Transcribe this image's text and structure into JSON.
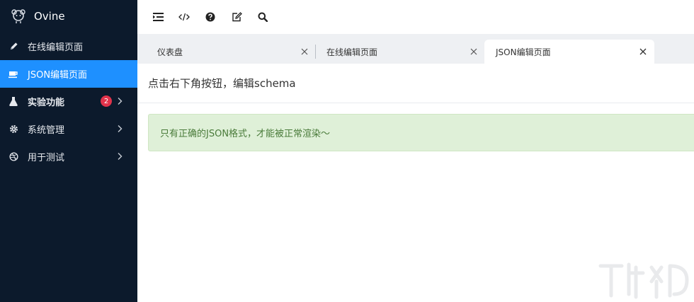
{
  "app": {
    "name": "Ovine"
  },
  "sidebar": {
    "items": [
      {
        "label": "在线编辑页面",
        "icon": "pencil-icon"
      },
      {
        "label": "JSON编辑页面",
        "icon": "cup-icon"
      },
      {
        "label": "实验功能",
        "icon": "flask-icon",
        "badge": "2"
      },
      {
        "label": "系统管理",
        "icon": "gear-icon"
      },
      {
        "label": "用于测试",
        "icon": "dribbble-icon"
      }
    ]
  },
  "toolbar": {
    "buttons": [
      "toggle-sidebar-icon",
      "code-icon",
      "help-icon",
      "edit-icon",
      "search-icon"
    ]
  },
  "tabs": [
    {
      "label": "仪表盘"
    },
    {
      "label": "在线编辑页面"
    },
    {
      "label": "JSON编辑页面"
    }
  ],
  "main": {
    "title": "点击右下角按钮，编辑schema",
    "alert": "只有正确的JSON格式，才能被正常渲染～"
  },
  "colors": {
    "sidebar_bg": "#0c1a2c",
    "active_blue": "#1e90ff",
    "badge_red": "#e0334b",
    "alert_bg": "#dff0d8",
    "alert_text": "#4a7b3a"
  }
}
